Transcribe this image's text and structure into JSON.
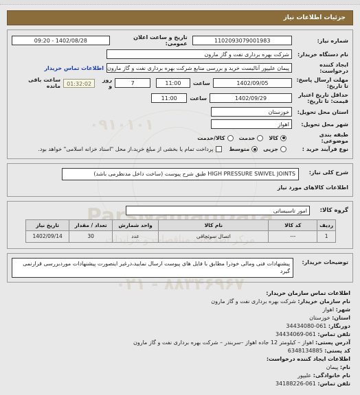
{
  "header": {
    "title": "جزئیات اطلاعات نیاز"
  },
  "form": {
    "need_number_label": "شماره نیاز:",
    "need_number_value": "1102093079001983",
    "announce_date_label": "تاریخ و ساعت اعلان عمومی:",
    "announce_date_value": "1402/08/28 - 09:20",
    "buyer_org_label": "نام دستگاه خریدار:",
    "buyer_org_value": "شرکت بهره برداری نفت و گاز مارون",
    "creator_label": "ایجاد کننده درخواست:",
    "creator_value": "پیمان علیپور آنالیست خرید و بررسی منابع شرکت بهره برداری نفت و گاز مارون",
    "buyer_contact_link": "اطلاعات تماس خریدار",
    "deadline_label": "مهلت ارسال پاسخ: تا تاریخ:",
    "deadline_date": "1402/09/05",
    "deadline_time_label": "ساعت",
    "deadline_time": "11:00",
    "days_value": "7",
    "days_unit": "روز و",
    "timer_value": "01:32:02",
    "timer_suffix": "ساعت باقی مانده",
    "validity_label": "حداقل تاریخ اعتبار قیمت: تا تاریخ:",
    "validity_date": "1402/09/29",
    "validity_time_label": "ساعت",
    "validity_time": "11:00",
    "province_label": "استان محل تحویل:",
    "province_value": "خوزستان",
    "city_label": "شهر محل تحویل:",
    "city_value": "اهواز",
    "category_label": "طبقه بندی موضوعی:",
    "category_options": [
      {
        "label": "کالا",
        "selected": true
      },
      {
        "label": "خدمت",
        "selected": false
      },
      {
        "label": "کالا/خدمت",
        "selected": false
      }
    ],
    "process_label": "نوع فرآیند خرید :",
    "process_options": [
      {
        "label": "جزیی",
        "selected": false
      },
      {
        "label": "متوسط",
        "selected": true
      }
    ],
    "checkbox_note": "پرداخت تمام یا بخشی از مبلغ خرید،از محل \"اسناد خزانه اسلامی\" خواهد بود.",
    "checkbox_checked": false
  },
  "description": {
    "label": "شرح کلی نیاز:",
    "value": "HIGH PRESSURE SWIVEL JOINTS طبق شرح پیوست (ساخت داخل مدنظرمی باشد)",
    "section_title": "اطلاعات کالاهای مورد نیاز"
  },
  "group": {
    "label": "گروه کالا:",
    "value": "امور تاسیساتی"
  },
  "table": {
    "columns": [
      "ردیف",
      "کد کالا",
      "نام کالا",
      "واحد شمارش",
      "تعداد / مقدار",
      "تاریخ نیاز"
    ],
    "rows": [
      {
        "row": "1",
        "code": "---",
        "name": "اتصال سوئچاقی",
        "unit": "عدد",
        "qty": "30",
        "date": "1402/09/14"
      }
    ]
  },
  "buyer_notes": {
    "label": "توضیحات خریدار:",
    "value": "پیشنهادات فنی ومالی خودرا مطابق با فایل های پیوست ارسال نمایید،درغیر اینصورت پیشنهادات موردبررسی قرارنمی گیرد"
  },
  "footer": {
    "buyer_contact_title": "اطلاعات تماس سازمان خریدار:",
    "buyer_org_label": "نام سازمان خریدار:",
    "buyer_org_value": "شرکت بهره برداری نفت و گاز مارون",
    "city_label": "شهر:",
    "city_value": "اهواز",
    "province_label": "استان:",
    "province_value": "خوزستان",
    "fax_label": "دورنگار:",
    "fax_value": "34434080-061",
    "phone_label": "تلفن تماس:",
    "phone_value": "34434069-061",
    "address_label": "آدرس پستی:",
    "address_value": "اهواز – کیلومتر 12 جاده اهواز –سربندر – شرکت بهره برداری نفت و گاز مارون",
    "postal_label": "کد پستی:",
    "postal_value": "6348134885",
    "creator_title": "اطلاعات ایجاد کننده درخواست:",
    "first_name_label": "نام:",
    "first_name_value": "پیمان",
    "last_name_label": "نام خانوادگی:",
    "last_name_value": "علیپور",
    "creator_phone_label": "تلفن تماس:",
    "creator_phone_value": "34188226-061"
  },
  "watermark": {
    "brand": "ParsNamadData",
    "sub": "مرکز اطلاعات مناقصات و مزایدات",
    "digits": "۰۲۱ - ۸۸۳۴۶۹۶۷",
    "digits2": "۰۹۱۰۱۰۱",
    "sub2": "بانک اطلاع رسانی مناقصه و مزایده"
  },
  "colors": {
    "header_bg": "#8a6d3b",
    "page_bg": "#e8e8e8",
    "link": "#1b3fae",
    "table_header_bg": "#dcdcdc"
  }
}
